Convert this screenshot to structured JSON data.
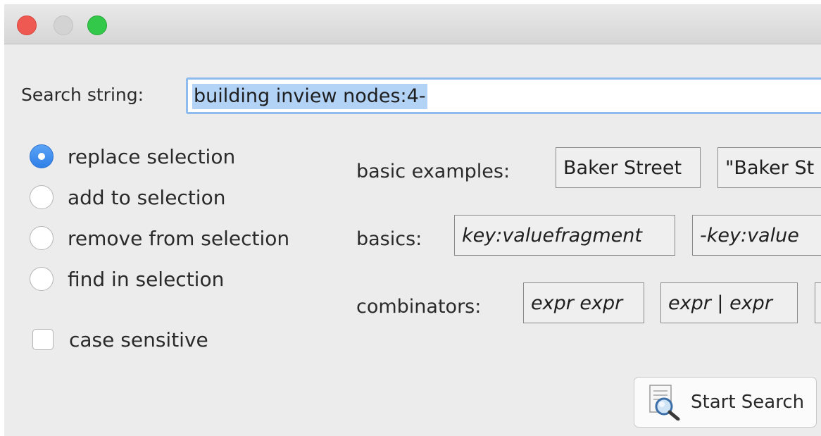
{
  "search": {
    "label": "Search string:",
    "value": "building inview nodes:4-"
  },
  "mode_options": [
    {
      "label": "replace selection",
      "checked": true
    },
    {
      "label": "add to selection",
      "checked": false
    },
    {
      "label": "remove from selection",
      "checked": false
    },
    {
      "label": "find in selection",
      "checked": false
    }
  ],
  "case_sensitive": {
    "label": "case sensitive",
    "checked": false
  },
  "examples": {
    "basic_examples_label": "basic examples:",
    "basic_examples": [
      "Baker Street",
      "\"Baker St"
    ],
    "basics_label": "basics:",
    "basics": [
      "key:valuefragment",
      "-key:value"
    ],
    "combinators_label": "combinators:",
    "combinators": [
      "expr expr",
      "expr | expr"
    ]
  },
  "start_search": {
    "label": "Start Search",
    "icon": "search-document-icon"
  },
  "window_controls": {
    "close_color": "#ee5a52",
    "minimize_color": "#d3d3d3",
    "zoom_color": "#34c84a"
  }
}
